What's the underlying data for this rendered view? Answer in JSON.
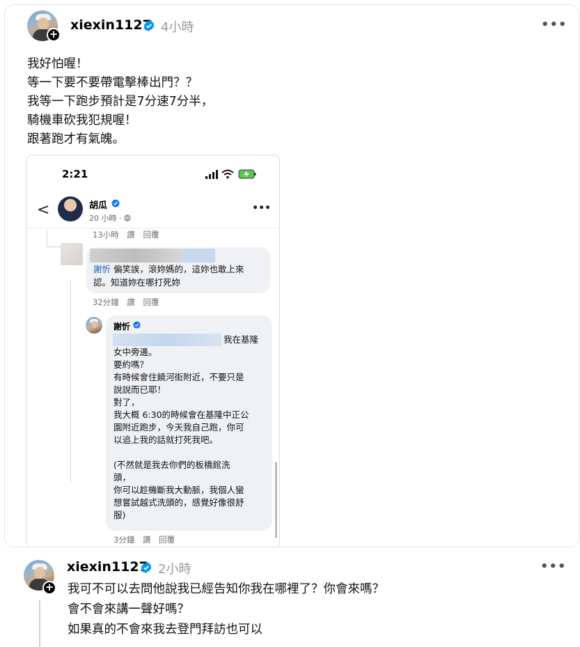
{
  "post": {
    "username": "xiexin1127",
    "time": "4小時",
    "more_label": "•••",
    "lines": [
      "我好怕喔！",
      "等一下要不要帶電擊棒出門？？",
      "我等一下跑步預計是7分速7分半，",
      "騎機車砍我犯規喔！",
      "跟著跑才有氣魄。"
    ]
  },
  "screenshot": {
    "status_time": "2:21",
    "back_label": "<",
    "page_name": "胡瓜",
    "page_sub": "20 小時 · ",
    "more_label": "•••",
    "meta_top": "13小時  讚  回覆",
    "comment1_name": "謝忻",
    "comment1_line1": " 偏笑誒，滾妳媽的，這妳也敢上來",
    "comment1_line2": "認。知道妳在哪打死妳",
    "meta_mid": "32分鐘  讚  回覆",
    "comment2_name": "謝忻",
    "comment2_lines": [
      "我在基隆",
      "女中旁邊。",
      "要約嗎？",
      "有時候會住饒河街附近，不要只是",
      "說說而已耶！",
      "對了，",
      "我大概 6:30的時候會在基隆中正公",
      "園附近跑步，今天我自己跑，你可",
      "以追上我的話就打死我吧。",
      "",
      "(不然就是我去你們的板橋館洗",
      "頭，",
      "你可以趁機斷我大動脈，我個人蠻",
      "想嘗試越式洗頭的，感覺好像很舒",
      "服)"
    ],
    "meta_bottom": "3分鐘  讚  回覆"
  },
  "reply": {
    "username": "xiexin1127",
    "time": "2小時",
    "more_label": "•••",
    "lines": [
      "我可不可以去問他說我已經告知你我在哪裡了？你會來嗎？",
      "會不會來講一聲好嗎？",
      "如果真的不會來我去登門拜訪也可以"
    ]
  },
  "colors": {
    "verified": "#0095f6",
    "fb_verified": "#1877f2",
    "link": "#1a5fb4",
    "muted": "#999999"
  }
}
